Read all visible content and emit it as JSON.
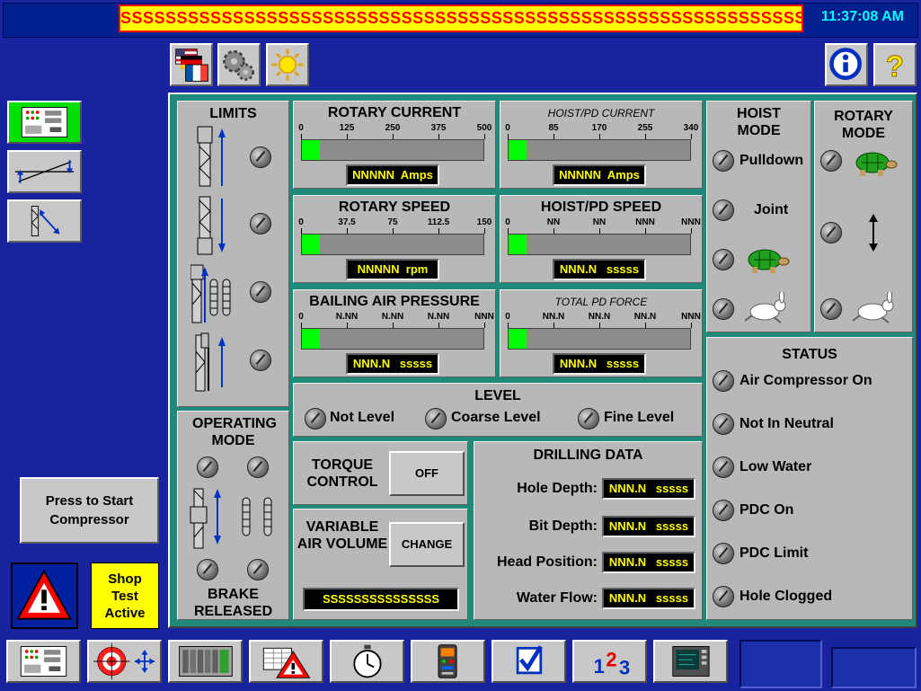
{
  "header": {
    "banner_text": "SSSSSSSSSSSSSSSSSSSSSSSSSSSSSSSSSSSSSSSSSSSSSSSSSSSSSSSSSSSSSSS",
    "clock": "11:37:08 AM"
  },
  "limits": {
    "title": "LIMITS"
  },
  "operating_mode": {
    "title": "OPERATING MODE",
    "footer": "BRAKE RELEASED"
  },
  "gauges": {
    "rotary_current": {
      "title": "ROTARY CURRENT",
      "scale": [
        "0",
        "125",
        "250",
        "375",
        "500"
      ],
      "readout": "NNNNN  Amps",
      "level": 0.1
    },
    "hoist_pd_current": {
      "title": "HOIST/PD CURRENT",
      "scale": [
        "0",
        "85",
        "170",
        "255",
        "340"
      ],
      "readout": "NNNNN  Amps",
      "level": 0.1
    },
    "rotary_speed": {
      "title": "ROTARY SPEED",
      "scale": [
        "0",
        "37.5",
        "75",
        "112.5",
        "150"
      ],
      "readout": "NNNNN  rpm",
      "level": 0.1
    },
    "hoist_pd_speed": {
      "title": "HOIST/PD SPEED",
      "scale": [
        "0",
        "NN",
        "NN",
        "NNN",
        "NNN"
      ],
      "readout": "NNN.N   sssss",
      "level": 0.1
    },
    "bailing_air_pressure": {
      "title": "BAILING AIR PRESSURE",
      "scale": [
        "0",
        "N.NN",
        "N.NN",
        "N.NN",
        "NNN"
      ],
      "readout": "NNN.N   sssss",
      "level": 0.1
    },
    "total_pd_force": {
      "title": "TOTAL PD FORCE",
      "scale": [
        "0",
        "NN.N",
        "NN.N",
        "NN.N",
        "NNN"
      ],
      "readout": "NNN.N   sssss",
      "level": 0.1
    }
  },
  "hoist_mode": {
    "title": "HOIST MODE",
    "pulldown": "Pulldown",
    "joint": "Joint"
  },
  "rotary_mode": {
    "title": "ROTARY MODE"
  },
  "level": {
    "title": "LEVEL",
    "items": [
      "Not Level",
      "Coarse Level",
      "Fine Level"
    ]
  },
  "torque": {
    "title": "TORQUE CONTROL",
    "button": "OFF"
  },
  "variable_air": {
    "title": "VARIABLE AIR VOLUME",
    "button": "CHANGE",
    "readout": "SSSSSSSSSSSSSSS"
  },
  "drilling_data": {
    "title": "DRILLING DATA",
    "rows": [
      {
        "label": "Hole Depth:",
        "value": "NNN.N   sssss"
      },
      {
        "label": "Bit Depth:",
        "value": "NNN.N   sssss"
      },
      {
        "label": "Head Position:",
        "value": "NNN.N   sssss"
      },
      {
        "label": "Water Flow:",
        "value": "NNN.N   sssss"
      }
    ]
  },
  "status": {
    "title": "STATUS",
    "items": [
      "Air Compressor On",
      "Not In Neutral",
      "Low Water",
      "PDC On",
      "PDC Limit",
      "Hole Clogged"
    ]
  },
  "left": {
    "compressor_button": "Press to Start Compressor",
    "shop_test": "Shop Test Active"
  },
  "bottom": {
    "numbers_icon": [
      "1",
      "2",
      "3"
    ]
  },
  "icons": {
    "language": "flags-icon",
    "settings": "gears-icon",
    "brightness": "sun-icon",
    "info": "info-icon",
    "help": "help-icon",
    "slow": "turtle-icon",
    "fast": "rabbit-icon"
  },
  "colors": {
    "background": "#1a239e",
    "panel": "#b8b8b8",
    "frame": "#1f8a7a",
    "gauge_fill": "#00ff00",
    "readout": "#ffff00",
    "alarm": "#ff0000"
  }
}
